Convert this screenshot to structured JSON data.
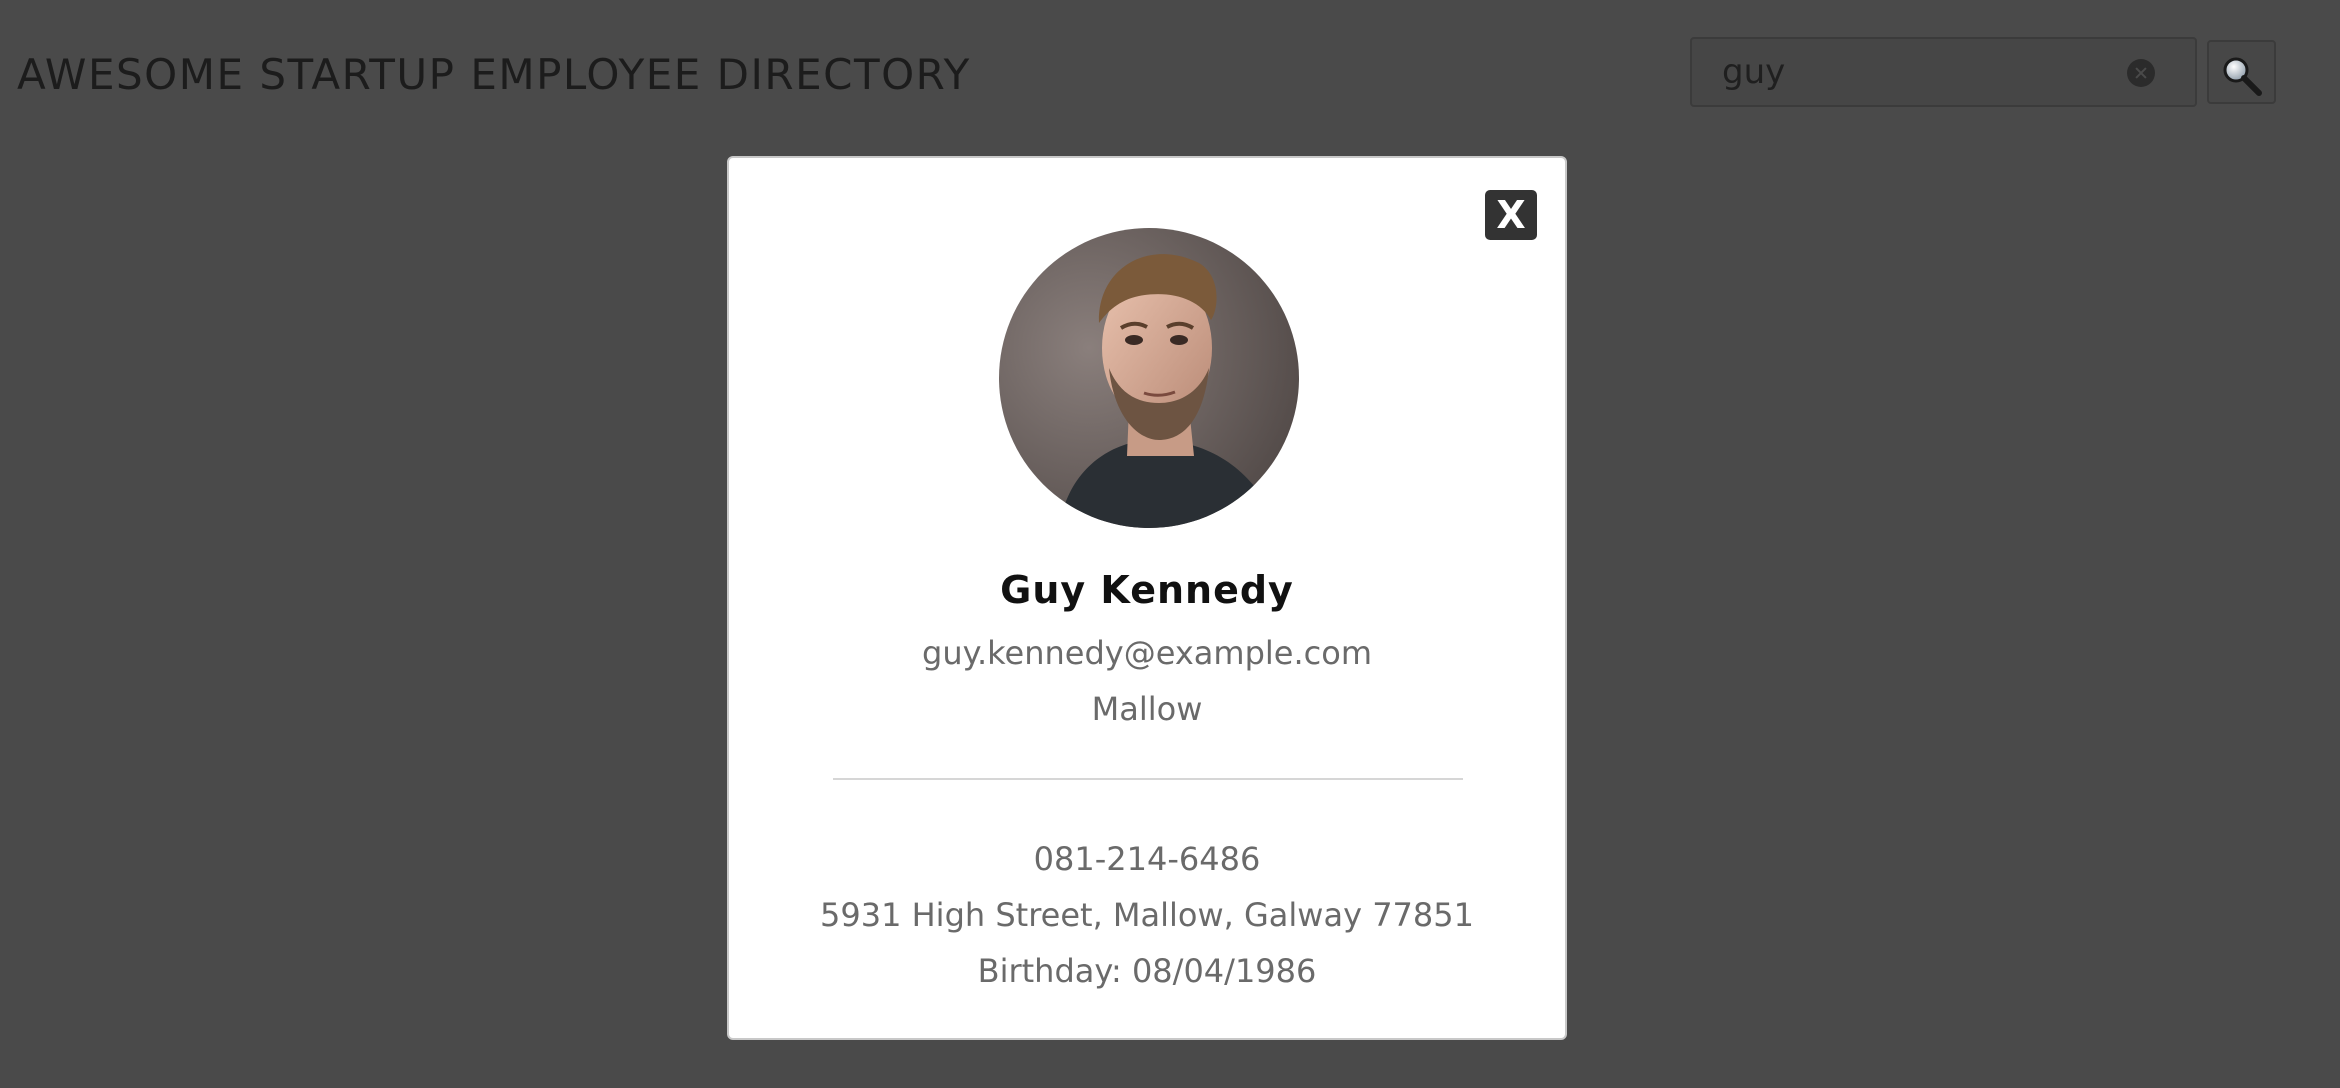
{
  "header": {
    "title": "AWESOME STARTUP EMPLOYEE DIRECTORY"
  },
  "search": {
    "value": "guy",
    "clear_icon": "clear-circle-icon",
    "button_icon": "magnifier-icon"
  },
  "modal": {
    "close_label": "X",
    "employee": {
      "name": "Guy Kennedy",
      "email": "guy.kennedy@example.com",
      "city": "Mallow",
      "phone": "081-214-6486",
      "address": "5931 High Street, Mallow, Galway 77851",
      "birthday": "Birthday: 08/04/1986"
    }
  },
  "colors": {
    "overlay_background": "#4a4a4a",
    "modal_background": "#ffffff",
    "close_button": "#333333",
    "secondary_text": "#6a6a6a"
  }
}
